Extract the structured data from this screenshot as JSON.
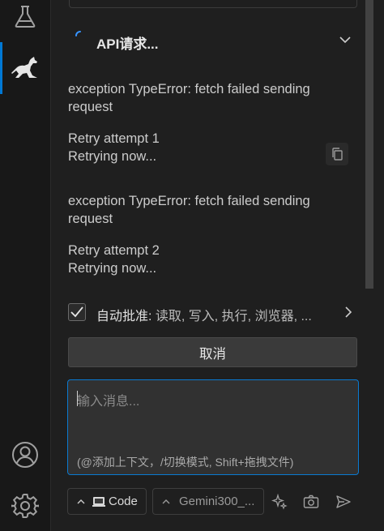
{
  "activity_bar": {
    "icons": [
      "flask-icon",
      "kangaroo-icon",
      "account-icon",
      "settings-gear-icon"
    ]
  },
  "api_request": {
    "title": "API请求...",
    "messages": [
      "exception TypeError: fetch failed sending request",
      "Retry attempt 1",
      "Retrying now...",
      "exception TypeError: fetch failed sending request",
      "Retry attempt 2",
      "Retrying now..."
    ]
  },
  "auto_approve": {
    "label": "自动批准:",
    "value": " 读取, 写入, 执行, 浏览器, ...",
    "checked": true
  },
  "cancel_button": {
    "label": "取消"
  },
  "chat_input": {
    "placeholder": "输入消息...",
    "hint": "(@添加上下文，/切换模式, Shift+拖拽文件)"
  },
  "toolbar": {
    "mode_label": "Code",
    "model_label": "Gemini300_..."
  },
  "colors": {
    "accent": "#0078d4",
    "background": "#1f1f1f",
    "activity_bar": "#181818"
  }
}
